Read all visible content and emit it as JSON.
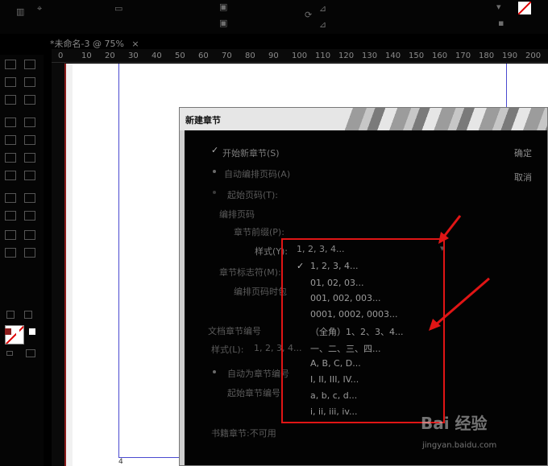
{
  "document": {
    "tab_label": "*未命名-3 @ 75%",
    "page_number": "4"
  },
  "ruler": {
    "ticks": [
      "0",
      "10",
      "20",
      "30",
      "40",
      "50",
      "60",
      "70",
      "80",
      "90",
      "100",
      "110",
      "120",
      "130",
      "140",
      "150",
      "160",
      "170",
      "180",
      "190",
      "200"
    ]
  },
  "dialog": {
    "title": "新建章节",
    "start_section": "开始新章节(S)",
    "auto_page_number": "自动编排页码(A)",
    "start_page_number": "起始页码(T):",
    "page_numbering": "编排页码",
    "section_prefix": "章节前缀(P):",
    "style_label": "样式(Y):",
    "section_marker": "章节标志符(M):",
    "include_prefix": "编排页码时包",
    "document_chapter": "文档章节编号",
    "style2_label": "样式(L):",
    "style2_value": "1, 2, 3, 4...",
    "auto_chapter": "自动为章节编号",
    "start_chapter": "起始章节编号",
    "book_chapter": "书籍章节:不可用",
    "ok_button": "确定",
    "cancel_button": "取消"
  },
  "style_dropdown": {
    "selected": "1, 2, 3, 4...",
    "options": [
      "1, 2, 3, 4...",
      "01, 02, 03...",
      "001, 002, 003...",
      "0001, 0002, 0003...",
      "（全角）1、2、3、4...",
      "一、二、三、四...",
      "A, B, C, D...",
      "I, II, III, IV...",
      "a, b, c, d...",
      "i, ii, iii, iv..."
    ]
  },
  "watermark": {
    "text": "Bai 经验",
    "url_text": "jingyan.baidu.com"
  },
  "colors": {
    "highlight": "#e01515",
    "margin_guide": "#4a4ad0"
  }
}
